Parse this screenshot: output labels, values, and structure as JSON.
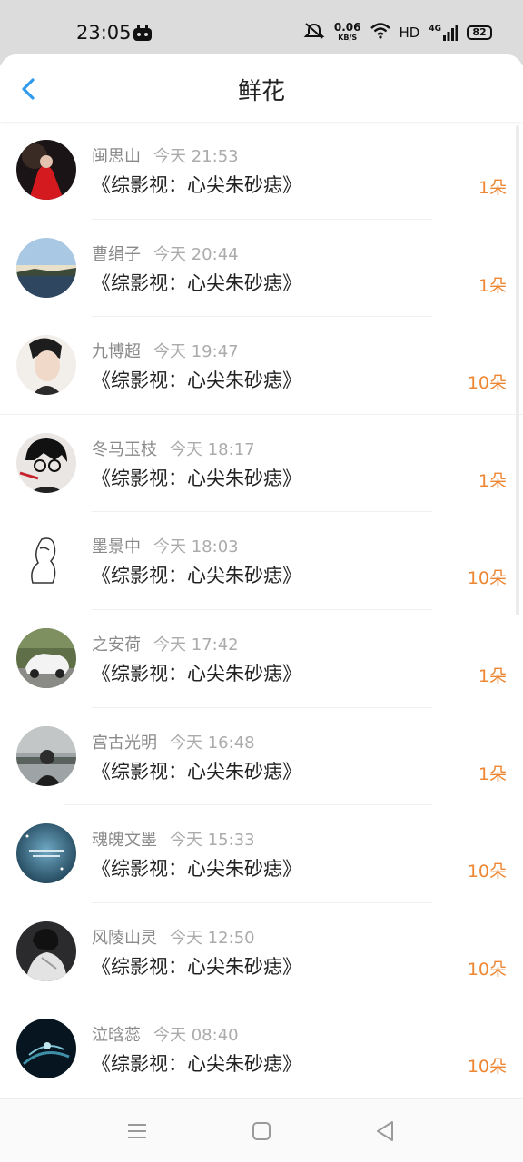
{
  "status_bar": {
    "time": "23:05",
    "speed_value": "0.06",
    "speed_unit": "KB/S",
    "hd": "HD",
    "network": "4G",
    "battery": "82",
    "icons": [
      "mute-icon",
      "wifi-icon",
      "signal-icon",
      "battery-icon"
    ]
  },
  "header": {
    "title": "鲜花",
    "back_icon": "chevron-left-icon",
    "accent_color": "#2e9bf0"
  },
  "list": {
    "items": [
      {
        "user": "闽思山",
        "time": "今天 21:53",
        "work": "《综影视：心尖朱砂痣》",
        "count": "1朵"
      },
      {
        "user": "曹绢子",
        "time": "今天 20:44",
        "work": "《综影视：心尖朱砂痣》",
        "count": "1朵"
      },
      {
        "user": "九博超",
        "time": "今天 19:47",
        "work": "《综影视：心尖朱砂痣》",
        "count": "10朵"
      },
      {
        "user": "冬马玉枝",
        "time": "今天 18:17",
        "work": "《综影视：心尖朱砂痣》",
        "count": "1朵"
      },
      {
        "user": "墨景中",
        "time": "今天 18:03",
        "work": "《综影视：心尖朱砂痣》",
        "count": "10朵"
      },
      {
        "user": "之安荷",
        "time": "今天 17:42",
        "work": "《综影视：心尖朱砂痣》",
        "count": "1朵"
      },
      {
        "user": "宫古光明",
        "time": "今天 16:48",
        "work": "《综影视：心尖朱砂痣》",
        "count": "1朵"
      },
      {
        "user": "魂魄文墨",
        "time": "今天 15:33",
        "work": "《综影视：心尖朱砂痣》",
        "count": "10朵"
      },
      {
        "user": "风陵山灵",
        "time": "今天 12:50",
        "work": "《综影视：心尖朱砂痣》",
        "count": "10朵"
      },
      {
        "user": "泣晗蕊",
        "time": "今天 08:40",
        "work": "《综影视：心尖朱砂痣》",
        "count": "10朵"
      }
    ],
    "count_color": "#ee8733"
  },
  "nav_bar": {
    "icons": [
      "menu-icon",
      "home-icon",
      "back-triangle-icon"
    ]
  }
}
